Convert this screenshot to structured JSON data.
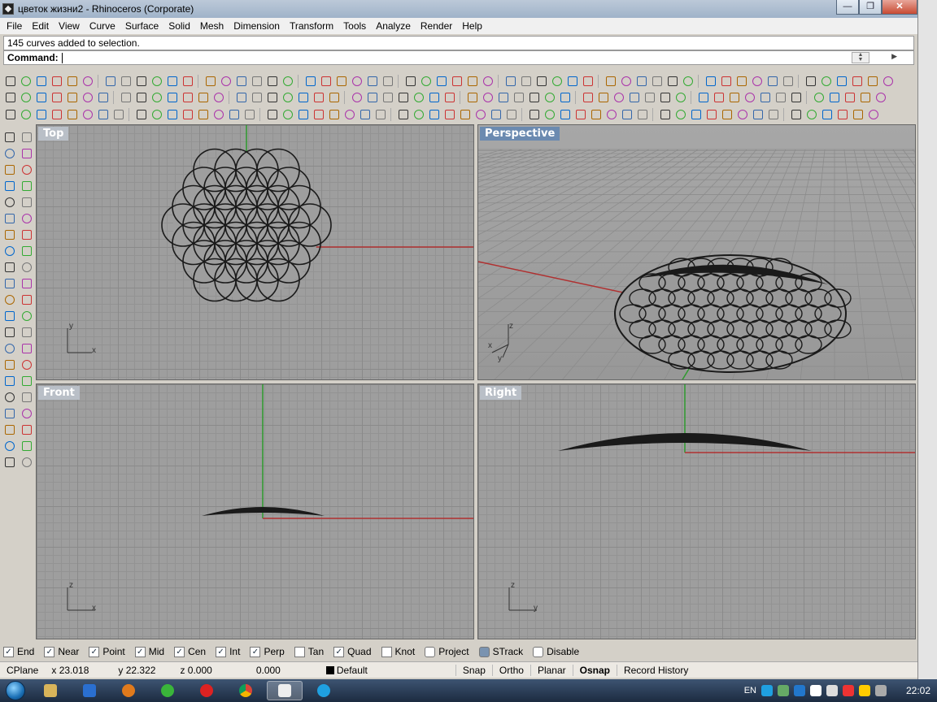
{
  "window": {
    "title": "цветок жизни2 - Rhinoceros (Corporate)"
  },
  "menu": [
    "File",
    "Edit",
    "View",
    "Curve",
    "Surface",
    "Solid",
    "Mesh",
    "Dimension",
    "Transform",
    "Tools",
    "Analyze",
    "Render",
    "Help"
  ],
  "command": {
    "history": "145 curves added to selection.",
    "prompt_label": "Command:",
    "value": ""
  },
  "viewports": {
    "top": {
      "label": "Top"
    },
    "perspective": {
      "label": "Perspective"
    },
    "front": {
      "label": "Front"
    },
    "right": {
      "label": "Right"
    }
  },
  "axis_glyphs": {
    "top": {
      "v": "y",
      "h": "x"
    },
    "perspective": {
      "z": "z",
      "x": "x",
      "y": "y"
    },
    "front": {
      "v": "z",
      "h": "x"
    },
    "right": {
      "v": "z",
      "h": "y"
    }
  },
  "osnap": [
    {
      "label": "End",
      "checked": true
    },
    {
      "label": "Near",
      "checked": true
    },
    {
      "label": "Point",
      "checked": true
    },
    {
      "label": "Mid",
      "checked": true
    },
    {
      "label": "Cen",
      "checked": true
    },
    {
      "label": "Int",
      "checked": true
    },
    {
      "label": "Perp",
      "checked": true
    },
    {
      "label": "Tan",
      "checked": false
    },
    {
      "label": "Quad",
      "checked": true
    },
    {
      "label": "Knot",
      "checked": false
    }
  ],
  "osnap_extra": [
    {
      "label": "Project",
      "checked": false
    },
    {
      "label": "STrack",
      "checked": true
    },
    {
      "label": "Disable",
      "checked": false
    }
  ],
  "status": {
    "cplane": "CPlane",
    "x": "x 23.018",
    "y": "y 22.322",
    "z": "z 0.000",
    "dist": "0.000",
    "layer": "Default",
    "snap": "Snap",
    "ortho": "Ortho",
    "planar": "Planar",
    "osnap": "Osnap",
    "record_history": "Record History"
  },
  "taskbar": {
    "lang": "EN",
    "clock": "22:02"
  },
  "colors": {
    "x_axis": "#b03030",
    "y_axis": "#2f9a2f",
    "curve": "#1a1a1a"
  }
}
